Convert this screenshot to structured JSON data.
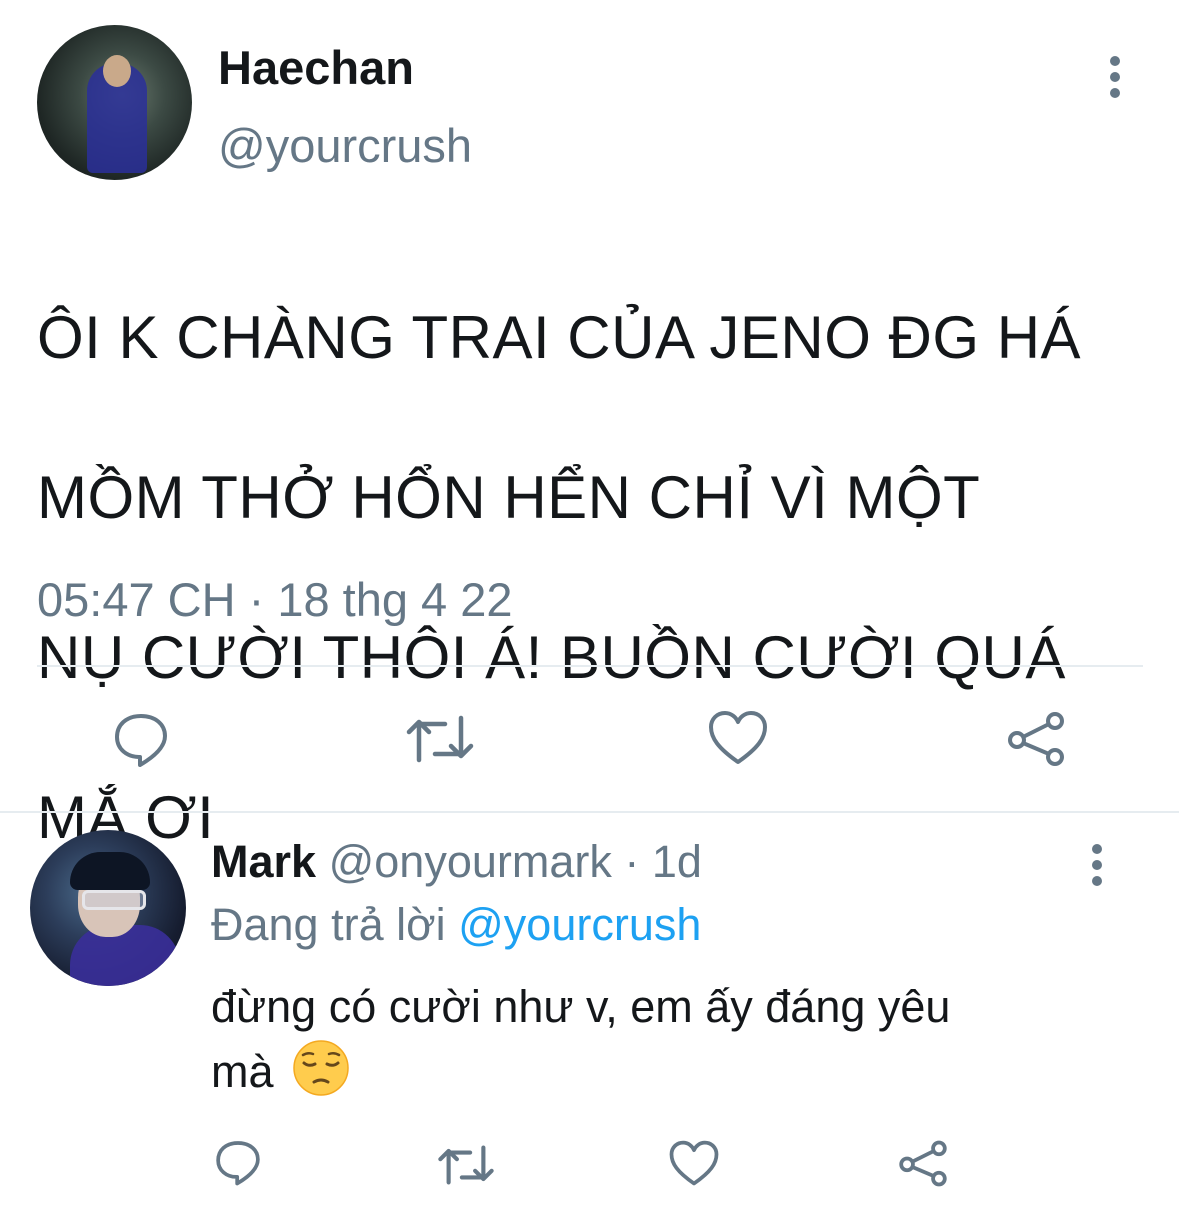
{
  "main_tweet": {
    "display_name": "Haechan",
    "handle": "@yourcrush",
    "text_lines": [
      "ÔI K CHÀNG TRAI CỦA JENO ĐG HÁ",
      "MỒM THỞ HỔN HỂN CHỈ VÌ MỘT",
      "NỤ CƯỜI THÔI Á! BUỒN CƯỜI QUÁ",
      "MẮ ƠI"
    ],
    "timestamp": "05:47 CH · 18 thg 4 22",
    "actions": [
      "reply-icon",
      "retweet-icon",
      "like-icon",
      "share-icon"
    ]
  },
  "reply_tweet": {
    "display_name": "Mark",
    "handle": "@onyourmark",
    "separator": " · ",
    "age": "1d",
    "replying_to_label": "Đang trả lời ",
    "replying_to_handle": "@yourcrush",
    "text_line1": "đừng có cười như v, em ấy đáng yêu",
    "text_line2": "mà",
    "emoji": "pensive-face-emoji",
    "actions": [
      "reply-icon",
      "retweet-icon",
      "like-icon",
      "share-icon"
    ]
  },
  "colors": {
    "text_primary": "#14171a",
    "text_secondary": "#657786",
    "link": "#1da1f2",
    "divider": "#e6ecf0"
  }
}
